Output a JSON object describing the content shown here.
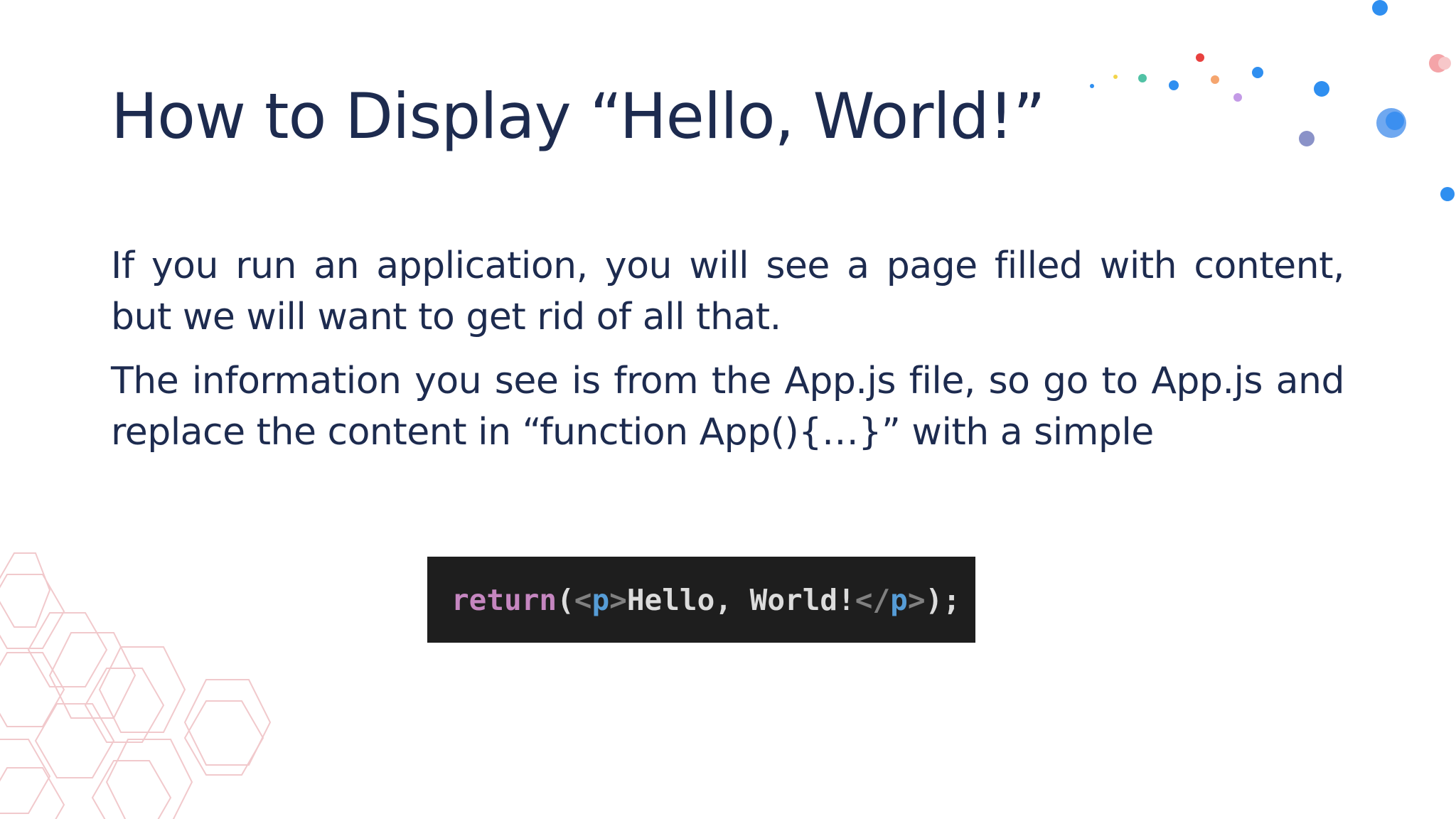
{
  "slide": {
    "title": "How to Display “Hello, World!”",
    "paragraphs": [
      "If you run an application, you will see a page filled with content, but we will want to get rid of all that.",
      "The information you see is from the App.js file, so go to App.js and replace the content in “function App(){…}” with a simple"
    ],
    "code": {
      "keyword": "return",
      "open_paren": "(",
      "open_tag_lt": "<",
      "open_tag_name": "p",
      "open_tag_gt": ">",
      "text": "Hello, World!",
      "close_tag_lt": "</",
      "close_tag_name": "p",
      "close_tag_gt": ">",
      "close": ");"
    }
  },
  "colors": {
    "title": "#1d2b4f",
    "body": "#1d2b4f",
    "code_background": "#1e1e1e",
    "code_keyword": "#c586c0",
    "code_tag_name": "#569cd6",
    "code_text": "#dcdcdc",
    "hexagon_outline": "#f1c9cc"
  }
}
